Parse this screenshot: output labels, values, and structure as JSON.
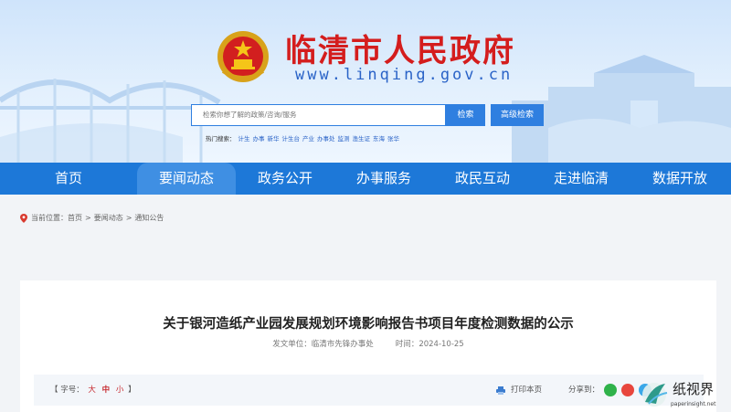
{
  "header": {
    "site_title": "临清市人民政府",
    "site_url": "www.linqing.gov.cn",
    "emblem_icon": "national-emblem-icon"
  },
  "search": {
    "placeholder": "检索你想了解的政策/咨询/服务",
    "button_label": "检索",
    "advanced_label": "高级检索",
    "hot_label": "热门搜索：",
    "hot_words": [
      "计生",
      "办事",
      "新华",
      "计生台",
      "产业",
      "办事处",
      "监测",
      "渔生证",
      "东海",
      "张华"
    ]
  },
  "nav": {
    "items": [
      "首页",
      "要闻动态",
      "政务公开",
      "办事服务",
      "政民互动",
      "走进临清",
      "数据开放"
    ],
    "active_index": 1
  },
  "breadcrumb": {
    "prefix": "当前位置：",
    "items": [
      "首页",
      "要闻动态",
      "通知公告"
    ],
    "separator": ">"
  },
  "article": {
    "title": "关于银河造纸产业园发展规划环境影响报告书项目年度检测数据的公示",
    "source_label": "发文单位：",
    "source": "临清市先锋办事处",
    "time_label": "时间：",
    "time": "2024-10-25"
  },
  "toolbar": {
    "font_label": "【 字号：",
    "font_large": "大",
    "font_medium": "中",
    "font_small": "小",
    "font_close": " 】",
    "print_label": "打印本页",
    "share_label": "分享到："
  },
  "watermark": {
    "text": "纸视界",
    "sub": "paperinsight.net"
  },
  "colors": {
    "nav_bg": "#1d78d8",
    "title_red": "#d41d1d",
    "accent_blue": "#2f7fe0",
    "wechat": "#2fb24a",
    "weibo": "#e8463d",
    "qq": "#3aa7e8"
  }
}
